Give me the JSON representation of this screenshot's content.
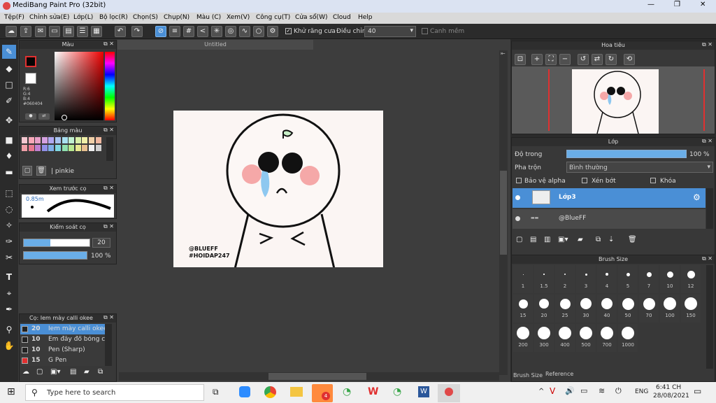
{
  "window": {
    "title": "MediBang Paint Pro (32bit)",
    "controls": [
      "—",
      "❐",
      "✕"
    ]
  },
  "menu": [
    "Tệp(F)",
    "Chỉnh sửa(E)",
    "Lớp(L)",
    "Bộ lọc(R)",
    "Chọn(S)",
    "Chụp(N)",
    "Màu (C)",
    "Xem(V)",
    "Công cụ(T)",
    "Cửa sổ(W)",
    "Cloud",
    "Help"
  ],
  "toolbar": {
    "antialias_label": "Khử răng cưa",
    "correction_label": "Điều chỉnh",
    "correction_value": "40",
    "snap_label": "Canh mềm"
  },
  "color_panel": {
    "title": "Màu",
    "r": "R:6",
    "g": "G:4",
    "b": "B:4",
    "hex": "#060404",
    "primary": "#060404",
    "secondary": "#ffffff"
  },
  "palette_panel": {
    "title": "Bảng màu",
    "palette_name": "pinkie",
    "swatches": [
      "#f4c7d0",
      "#f7a8b8",
      "#e8a0c8",
      "#d4a0e0",
      "#b0a8f0",
      "#a8c4f0",
      "#a8e0f0",
      "#c0f0d0",
      "#d8f0a8",
      "#f0f0a8",
      "#f0d0a8",
      "#f0b8a0",
      "#f0a0a8",
      "#e87890",
      "#c080d0",
      "#9090e8",
      "#80b0e8",
      "#80d8e0",
      "#90e0b0",
      "#b8e890",
      "#e8e890",
      "#e8c090",
      "#f0f0f0",
      "#d0d0d0"
    ]
  },
  "preview_panel": {
    "title": "Xem trước cọ",
    "size_label": "0.85m"
  },
  "brush_control": {
    "title": "Kiểm soát cọ",
    "size_value": "20",
    "opacity_value": "100 %"
  },
  "brush_list": {
    "title": "Cọ: Iem mày calli okee",
    "items": [
      {
        "size": "20",
        "name": "Iem mày calli okee",
        "color": "#222",
        "selected": true
      },
      {
        "size": "10",
        "name": "Em đây đổ bóng cu",
        "color": "#222",
        "selected": false
      },
      {
        "size": "10",
        "name": "Pen (Sharp)",
        "color": "#222",
        "selected": false
      },
      {
        "size": "15",
        "name": "G Pen",
        "color": "#e03030",
        "selected": false
      }
    ]
  },
  "document": {
    "tab": "Untitled",
    "watermark_1": "@BLUEFF",
    "watermark_2": "#HOIDAP247"
  },
  "navigator": {
    "title": "Hoa tiêu"
  },
  "layers": {
    "title": "Lớp",
    "opacity_label": "Độ trong",
    "opacity_value": "100 %",
    "blend_label": "Pha trộn",
    "blend_value": "Bình thường",
    "protect_alpha": "Bảo vệ alpha",
    "clipping": "Xén bớt",
    "lock": "Khóa",
    "rows": [
      {
        "name": "Lớp3",
        "selected": true
      },
      {
        "name": "@BlueFF",
        "selected": false
      }
    ]
  },
  "brush_size": {
    "title": "Brush Size",
    "sizes": [
      "1",
      "1.5",
      "2",
      "3",
      "4",
      "5",
      "7",
      "10",
      "12",
      "15",
      "20",
      "25",
      "30",
      "40",
      "50",
      "70",
      "100",
      "150",
      "200",
      "300",
      "400",
      "500",
      "700",
      "1000"
    ],
    "tabs": [
      "Brush Size",
      "Reference"
    ]
  },
  "taskbar": {
    "search_placeholder": "Type here to search",
    "time": "6:41 CH",
    "date": "28/08/2021",
    "lang": "ENG",
    "badge": "4"
  }
}
